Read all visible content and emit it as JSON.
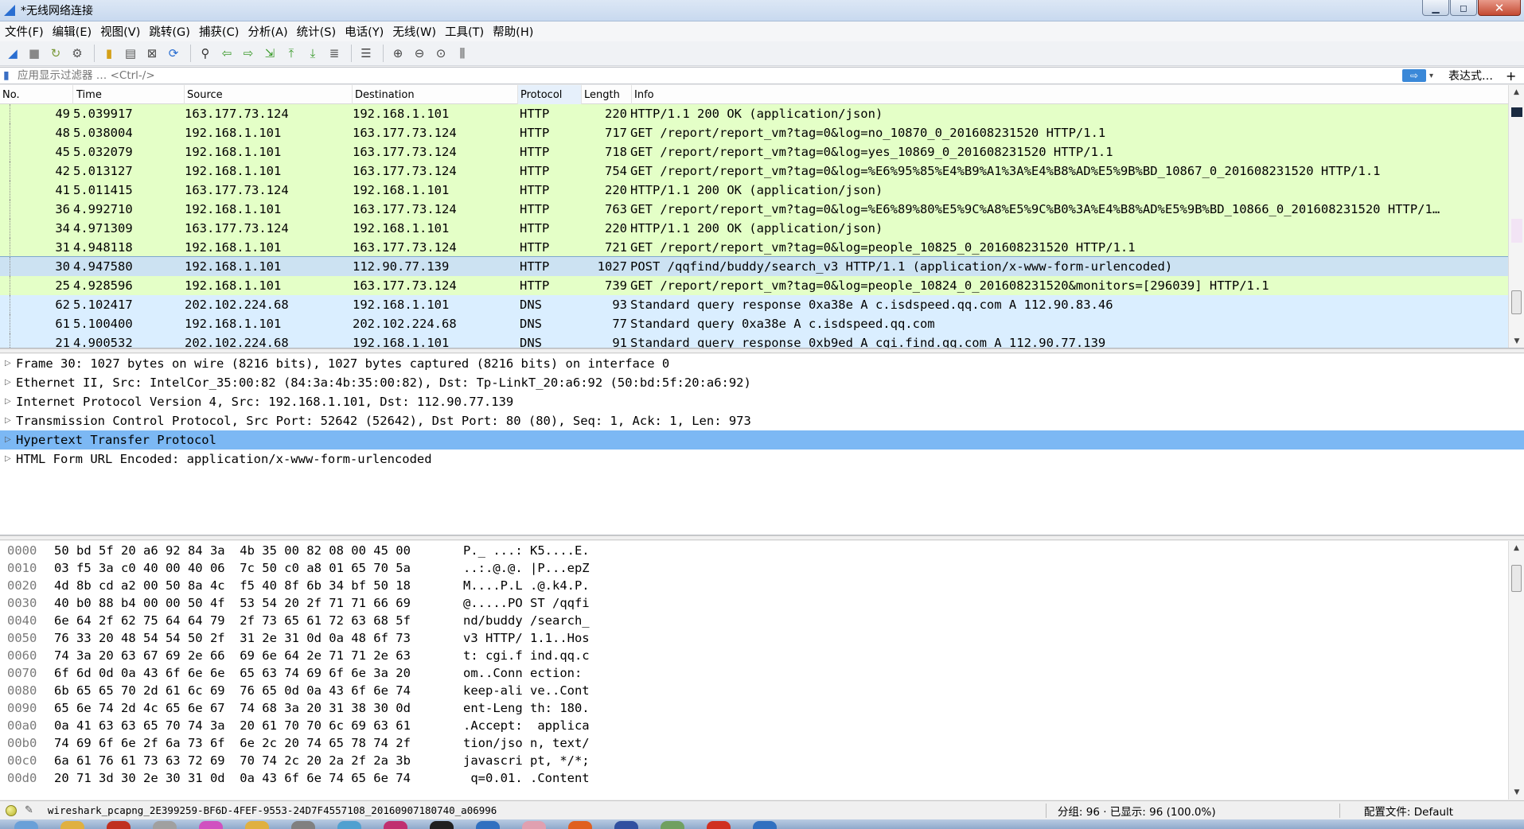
{
  "window": {
    "title": "*无线网络连接",
    "minimize": "▁",
    "maximize": "◻",
    "close": "✕"
  },
  "menu": [
    "文件(F)",
    "编辑(E)",
    "视图(V)",
    "跳转(G)",
    "捕获(C)",
    "分析(A)",
    "统计(S)",
    "电话(Y)",
    "无线(W)",
    "工具(T)",
    "帮助(H)"
  ],
  "toolbar_icons": [
    {
      "name": "start-capture-icon",
      "glyph": "◢",
      "color": "#2a6ed1"
    },
    {
      "name": "stop-capture-icon",
      "glyph": "■",
      "color": "#888888"
    },
    {
      "name": "restart-capture-icon",
      "glyph": "↻",
      "color": "#7a9a3a"
    },
    {
      "name": "capture-options-icon",
      "glyph": "⚙",
      "color": "#555555"
    },
    {
      "name": "sep"
    },
    {
      "name": "open-file-icon",
      "glyph": "▮",
      "color": "#d4a017"
    },
    {
      "name": "save-file-icon",
      "glyph": "▤",
      "color": "#555555"
    },
    {
      "name": "close-file-icon",
      "glyph": "⊠",
      "color": "#444444"
    },
    {
      "name": "reload-file-icon",
      "glyph": "⟳",
      "color": "#2a6ed1"
    },
    {
      "name": "sep"
    },
    {
      "name": "find-packet-icon",
      "glyph": "⚲",
      "color": "#333333"
    },
    {
      "name": "go-back-icon",
      "glyph": "⇦",
      "color": "#3a9a2a"
    },
    {
      "name": "go-forward-icon",
      "glyph": "⇨",
      "color": "#3a9a2a"
    },
    {
      "name": "go-to-packet-icon",
      "glyph": "⇲",
      "color": "#3a9a2a"
    },
    {
      "name": "go-first-icon",
      "glyph": "⤒",
      "color": "#3a9a2a"
    },
    {
      "name": "go-last-icon",
      "glyph": "⤓",
      "color": "#3a9a2a"
    },
    {
      "name": "auto-scroll-icon",
      "glyph": "≣",
      "color": "#555555"
    },
    {
      "name": "sep"
    },
    {
      "name": "colorize-icon",
      "glyph": "☰",
      "color": "#444444"
    },
    {
      "name": "sep"
    },
    {
      "name": "zoom-in-icon",
      "glyph": "⊕",
      "color": "#444444"
    },
    {
      "name": "zoom-out-icon",
      "glyph": "⊖",
      "color": "#444444"
    },
    {
      "name": "zoom-normal-icon",
      "glyph": "⊙",
      "color": "#444444"
    },
    {
      "name": "resize-columns-icon",
      "glyph": "⫼",
      "color": "#444444"
    }
  ],
  "filter": {
    "placeholder": "应用显示过滤器 … <Ctrl-/>",
    "apply": "⇨",
    "dropdown": "▾",
    "expression": "表达式…",
    "add": "+"
  },
  "packet_list": {
    "columns": [
      "No.",
      "Time",
      "Source",
      "Destination",
      "Protocol",
      "Length",
      "Info"
    ],
    "rows": [
      {
        "no": "49",
        "time": "5.039917",
        "src": "163.177.73.124",
        "dst": "192.168.1.101",
        "proto": "HTTP",
        "len": "220",
        "info": "HTTP/1.1 200 OK  (application/json)",
        "kind": "http"
      },
      {
        "no": "48",
        "time": "5.038004",
        "src": "192.168.1.101",
        "dst": "163.177.73.124",
        "proto": "HTTP",
        "len": "717",
        "info": "GET /report/report_vm?tag=0&log=no_10870_0_201608231520 HTTP/1.1",
        "kind": "http"
      },
      {
        "no": "45",
        "time": "5.032079",
        "src": "192.168.1.101",
        "dst": "163.177.73.124",
        "proto": "HTTP",
        "len": "718",
        "info": "GET /report/report_vm?tag=0&log=yes_10869_0_201608231520 HTTP/1.1",
        "kind": "http"
      },
      {
        "no": "42",
        "time": "5.013127",
        "src": "192.168.1.101",
        "dst": "163.177.73.124",
        "proto": "HTTP",
        "len": "754",
        "info": "GET /report/report_vm?tag=0&log=%E6%95%85%E4%B9%A1%3A%E4%B8%AD%E5%9B%BD_10867_0_201608231520 HTTP/1.1",
        "kind": "http"
      },
      {
        "no": "41",
        "time": "5.011415",
        "src": "163.177.73.124",
        "dst": "192.168.1.101",
        "proto": "HTTP",
        "len": "220",
        "info": "HTTP/1.1 200 OK  (application/json)",
        "kind": "http"
      },
      {
        "no": "36",
        "time": "4.992710",
        "src": "192.168.1.101",
        "dst": "163.177.73.124",
        "proto": "HTTP",
        "len": "763",
        "info": "GET /report/report_vm?tag=0&log=%E6%89%80%E5%9C%A8%E5%9C%B0%3A%E4%B8%AD%E5%9B%BD_10866_0_201608231520 HTTP/1…",
        "kind": "http"
      },
      {
        "no": "34",
        "time": "4.971309",
        "src": "163.177.73.124",
        "dst": "192.168.1.101",
        "proto": "HTTP",
        "len": "220",
        "info": "HTTP/1.1 200 OK  (application/json)",
        "kind": "http"
      },
      {
        "no": "31",
        "time": "4.948118",
        "src": "192.168.1.101",
        "dst": "163.177.73.124",
        "proto": "HTTP",
        "len": "721",
        "info": "GET /report/report_vm?tag=0&log=people_10825_0_201608231520 HTTP/1.1",
        "kind": "http"
      },
      {
        "no": "30",
        "time": "4.947580",
        "src": "192.168.1.101",
        "dst": "112.90.77.139",
        "proto": "HTTP",
        "len": "1027",
        "info": "POST /qqfind/buddy/search_v3 HTTP/1.1  (application/x-www-form-urlencoded)",
        "kind": "selected"
      },
      {
        "no": "25",
        "time": "4.928596",
        "src": "192.168.1.101",
        "dst": "163.177.73.124",
        "proto": "HTTP",
        "len": "739",
        "info": "GET /report/report_vm?tag=0&log=people_10824_0_201608231520&monitors=[296039] HTTP/1.1",
        "kind": "http"
      },
      {
        "no": "62",
        "time": "5.102417",
        "src": "202.102.224.68",
        "dst": "192.168.1.101",
        "proto": "DNS",
        "len": "93",
        "info": "Standard query response 0xa38e A c.isdspeed.qq.com A 112.90.83.46",
        "kind": "dns"
      },
      {
        "no": "61",
        "time": "5.100400",
        "src": "192.168.1.101",
        "dst": "202.102.224.68",
        "proto": "DNS",
        "len": "77",
        "info": "Standard query 0xa38e A c.isdspeed.qq.com",
        "kind": "dns"
      },
      {
        "no": "21",
        "time": "4.900532",
        "src": "202.102.224.68",
        "dst": "192.168.1.101",
        "proto": "DNS",
        "len": "91",
        "info": "Standard query response 0xb9ed A cgi.find.qq.com A 112.90.77.139",
        "kind": "dns"
      }
    ]
  },
  "details": [
    "Frame 30: 1027 bytes on wire (8216 bits), 1027 bytes captured (8216 bits) on interface 0",
    "Ethernet II, Src: IntelCor_35:00:82 (84:3a:4b:35:00:82), Dst: Tp-LinkT_20:a6:92 (50:bd:5f:20:a6:92)",
    "Internet Protocol Version 4, Src: 192.168.1.101, Dst: 112.90.77.139",
    "Transmission Control Protocol, Src Port: 52642 (52642), Dst Port: 80 (80), Seq: 1, Ack: 1, Len: 973",
    "Hypertext Transfer Protocol",
    "HTML Form URL Encoded: application/x-www-form-urlencoded"
  ],
  "details_selected": 4,
  "hex": [
    {
      "off": "0000",
      "bytes": "50 bd 5f 20 a6 92 84 3a  4b 35 00 82 08 00 45 00",
      "ascii": "P._ ...: K5....E."
    },
    {
      "off": "0010",
      "bytes": "03 f5 3a c0 40 00 40 06  7c 50 c0 a8 01 65 70 5a",
      "ascii": "..:.@.@. |P...epZ"
    },
    {
      "off": "0020",
      "bytes": "4d 8b cd a2 00 50 8a 4c  f5 40 8f 6b 34 bf 50 18",
      "ascii": "M....P.L .@.k4.P."
    },
    {
      "off": "0030",
      "bytes": "40 b0 88 b4 00 00 50 4f  53 54 20 2f 71 71 66 69",
      "ascii": "@.....PO ST /qqfi"
    },
    {
      "off": "0040",
      "bytes": "6e 64 2f 62 75 64 64 79  2f 73 65 61 72 63 68 5f",
      "ascii": "nd/buddy /search_"
    },
    {
      "off": "0050",
      "bytes": "76 33 20 48 54 54 50 2f  31 2e 31 0d 0a 48 6f 73",
      "ascii": "v3 HTTP/ 1.1..Hos"
    },
    {
      "off": "0060",
      "bytes": "74 3a 20 63 67 69 2e 66  69 6e 64 2e 71 71 2e 63",
      "ascii": "t: cgi.f ind.qq.c"
    },
    {
      "off": "0070",
      "bytes": "6f 6d 0d 0a 43 6f 6e 6e  65 63 74 69 6f 6e 3a 20",
      "ascii": "om..Conn ection: "
    },
    {
      "off": "0080",
      "bytes": "6b 65 65 70 2d 61 6c 69  76 65 0d 0a 43 6f 6e 74",
      "ascii": "keep-ali ve..Cont"
    },
    {
      "off": "0090",
      "bytes": "65 6e 74 2d 4c 65 6e 67  74 68 3a 20 31 38 30 0d",
      "ascii": "ent-Leng th: 180."
    },
    {
      "off": "00a0",
      "bytes": "0a 41 63 63 65 70 74 3a  20 61 70 70 6c 69 63 61",
      "ascii": ".Accept:  applica"
    },
    {
      "off": "00b0",
      "bytes": "74 69 6f 6e 2f 6a 73 6f  6e 2c 20 74 65 78 74 2f",
      "ascii": "tion/jso n, text/"
    },
    {
      "off": "00c0",
      "bytes": "6a 61 76 61 73 63 72 69  70 74 2c 20 2a 2f 2a 3b",
      "ascii": "javascri pt, */*;"
    },
    {
      "off": "00d0",
      "bytes": "20 71 3d 30 2e 30 31 0d  0a 43 6f 6e 74 65 6e 74",
      "ascii": " q=0.01. .Content"
    }
  ],
  "status": {
    "file": "wireshark_pcapng_2E399259-BF6D-4FEF-9553-24D7F4557108_20160907180740_a06996",
    "stats": "分组: 96 · 已显示: 96 (100.0%)",
    "profile": "配置文件: Default"
  },
  "colors": {
    "http_row": "#e4ffc7",
    "dns_row": "#daeeff",
    "selected_row": "#cce2f2",
    "selected_detail": "#7cb8f4"
  }
}
